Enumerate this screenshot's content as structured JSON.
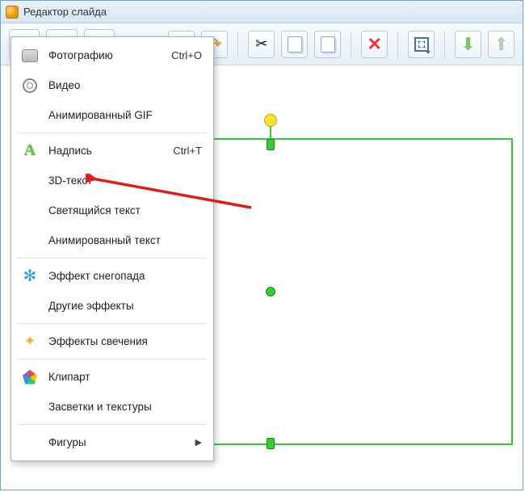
{
  "window": {
    "title": "Редактор слайда"
  },
  "toolbar": {
    "add": "add",
    "snow": "snow-effect",
    "camera": "camera",
    "undo": "undo",
    "redo": "redo",
    "cut": "cut",
    "copy": "copy",
    "paste": "paste",
    "delete": "delete",
    "fit": "fit-screen",
    "down": "move-down",
    "up": "move-up"
  },
  "menu": {
    "items": [
      {
        "icon": "photo",
        "label": "Фотографию",
        "shortcut": "Ctrl+O"
      },
      {
        "icon": "video",
        "label": "Видео",
        "shortcut": ""
      },
      {
        "icon": "",
        "label": "Анимированный GIF",
        "shortcut": ""
      },
      {
        "sep": true
      },
      {
        "icon": "text",
        "label": "Надпись",
        "shortcut": "Ctrl+T"
      },
      {
        "icon": "",
        "label": "3D-текст",
        "shortcut": ""
      },
      {
        "icon": "",
        "label": "Светящийся текст",
        "shortcut": ""
      },
      {
        "icon": "",
        "label": "Анимированный текст",
        "shortcut": ""
      },
      {
        "sep": true
      },
      {
        "icon": "snow",
        "label": "Эффект снегопада",
        "shortcut": ""
      },
      {
        "icon": "",
        "label": "Другие эффекты",
        "shortcut": ""
      },
      {
        "sep": true
      },
      {
        "icon": "spark",
        "label": "Эффекты свечения",
        "shortcut": ""
      },
      {
        "sep": true
      },
      {
        "icon": "clip",
        "label": "Клипарт",
        "shortcut": ""
      },
      {
        "icon": "",
        "label": "Засветки и текстуры",
        "shortcut": ""
      },
      {
        "sep": true
      },
      {
        "icon": "",
        "label": "Фигуры",
        "shortcut": "",
        "submenu": true
      }
    ]
  },
  "annotation": {
    "target_label": "Надпись"
  }
}
